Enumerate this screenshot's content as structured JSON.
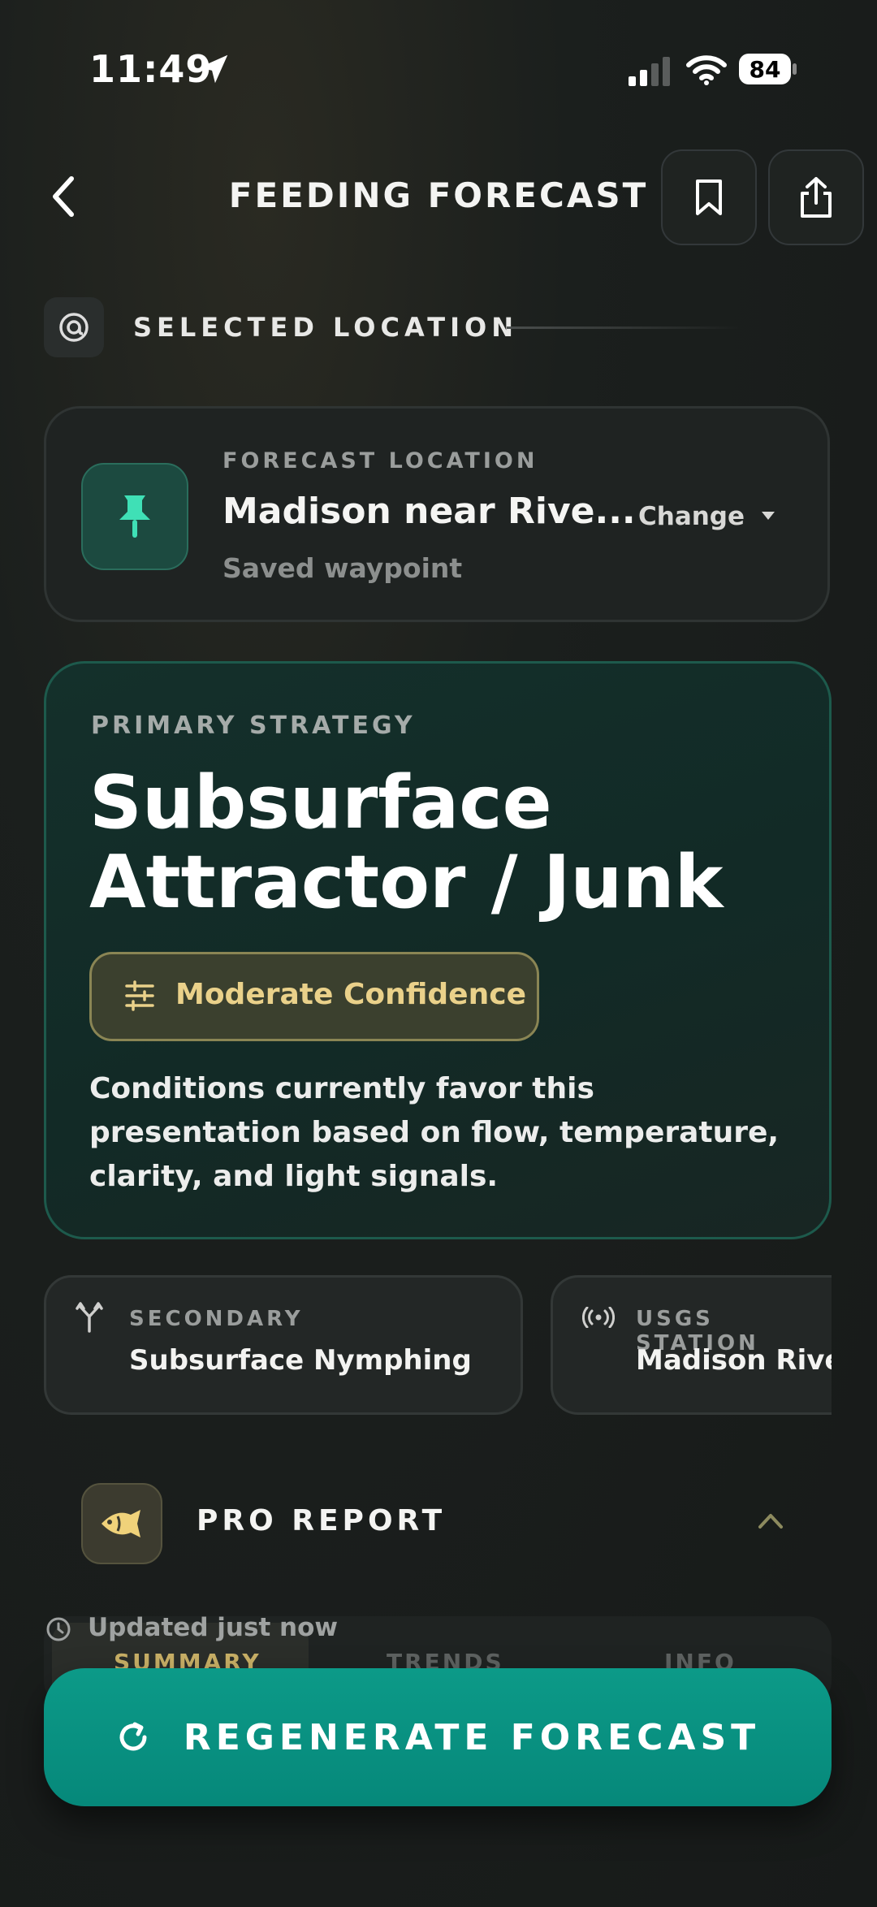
{
  "status_bar": {
    "time": "11:49",
    "battery": "84"
  },
  "header": {
    "title": "FEEDING FORECAST"
  },
  "selected_location": {
    "label": "SELECTED LOCATION"
  },
  "forecast_location": {
    "label": "FORECAST LOCATION",
    "name": "Madison near Rive...",
    "subtitle": "Saved waypoint",
    "change_label": "Change"
  },
  "primary_strategy": {
    "label": "PRIMARY STRATEGY",
    "title_line1": "Subsurface",
    "title_line2": "Attractor / Junk",
    "confidence": "Moderate Confidence",
    "description": "Conditions currently favor this presentation based on flow, temperature, clarity, and light signals."
  },
  "secondary": {
    "label": "SECONDARY",
    "value": "Subsurface Nymphing"
  },
  "usgs_station": {
    "label": "USGS STATION",
    "value": "Madison River"
  },
  "pro_report": {
    "label": "PRO REPORT",
    "updated": "Updated just now",
    "tabs": [
      "SUMMARY",
      "TRENDS",
      "INFO"
    ]
  },
  "regenerate_button": {
    "label": "REGENERATE FORECAST"
  },
  "colors": {
    "accent_teal": "#0c9a88",
    "confidence_gold": "#ead18a"
  }
}
